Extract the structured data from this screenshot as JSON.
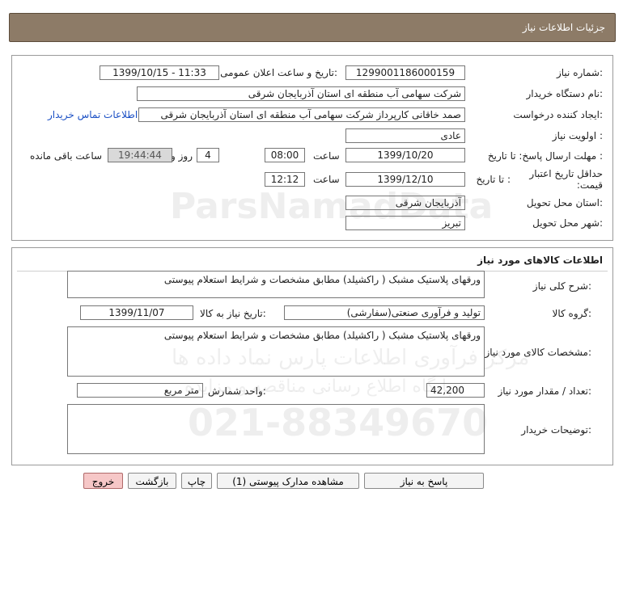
{
  "header": {
    "title": "جزئیات اطلاعات نیاز"
  },
  "need_info": {
    "need_number_label": "شماره نیاز:",
    "need_number": "1299001186000159",
    "announce_label": "تاریخ و ساعت اعلان عمومی:",
    "announce_value": "1399/10/15 - 11:33",
    "buyer_label": "نام دستگاه خریدار:",
    "buyer_value": "شرکت سهامی آب منطقه ای استان آذربایجان شرقی",
    "creator_label": "ایجاد کننده درخواست:",
    "creator_value": "صمد خاقانی کارپرداز شرکت سهامی آب منطقه ای استان آذربایجان شرقی",
    "contact_link": "اطلاعات تماس خریدار",
    "priority_label": "اولویت نیاز :",
    "priority_value": "عادی",
    "deadline_label": "مهلت ارسال پاسخ: تا تاریخ :",
    "deadline_date": "1399/10/20",
    "deadline_time_label": "ساعت",
    "deadline_time": "08:00",
    "days_value": "4",
    "days_label": "روز و",
    "remaining_time": "19:44:44",
    "remaining_label": "ساعت باقی مانده",
    "min_validity_label": "حداقل تاریخ اعتبار قیمت:",
    "min_validity_until": "تا تاریخ :",
    "validity_date": "1399/12/10",
    "validity_time_label": "ساعت",
    "validity_time": "12:12",
    "province_label": "استان محل تحویل:",
    "province_value": "آذربایجان شرقی",
    "city_label": "شهر محل تحویل:",
    "city_value": "تبریز"
  },
  "goods": {
    "section_title": "اطلاعات کالاهای مورد نیاز",
    "general_desc_label": "شرح کلی نیاز:",
    "general_desc": "ورقهای پلاستیک مشبک ( راکشیلد) مطابق مشخصات و شرایط استعلام پیوستی",
    "group_label": "گروه کالا:",
    "group_value": "تولید و فرآوری صنعتی(سفارشی)",
    "need_date_label": "تاریخ نیاز به کالا:",
    "need_date": "1399/11/07",
    "spec_label": "مشخصات کالای مورد نیاز:",
    "spec_value": "ورقهای پلاستیک مشبک ( راکشیلد) مطابق مشخصات و شرایط استعلام پیوستی",
    "quantity_label": "تعداد / مقدار مورد نیاز:",
    "quantity_value": "42,200",
    "unit_label": "واحد شمارش:",
    "unit_value": "متر مربع",
    "buyer_notes_label": "توضیحات خریدار:",
    "buyer_notes": ""
  },
  "buttons": {
    "reply": "پاسخ به نیاز",
    "attachments": "مشاهده مدارک پیوستی (1)",
    "print": "چاپ",
    "back": "بازگشت",
    "exit": "خروج"
  },
  "watermark": {
    "brand": "ParsNamadData",
    "line1": "مرکز فرآوری اطلاعات پارس نماد داده ها",
    "line2": "پایگاه اطلاع رسانی مناقصه و مزایده",
    "phone": "021-88349670"
  }
}
